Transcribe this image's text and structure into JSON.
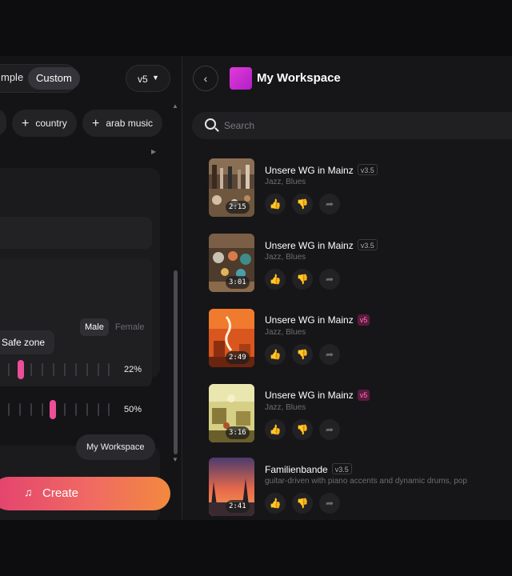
{
  "left": {
    "mode": {
      "simple_label": "mple",
      "custom_label": "Custom"
    },
    "version": {
      "label": "v5"
    },
    "chips": [
      {
        "label": "country"
      },
      {
        "label": "arab music"
      }
    ],
    "gender": {
      "male": "Male",
      "female": "Female"
    },
    "tooltip": "Safe zone",
    "sliders": [
      {
        "value": "22%"
      },
      {
        "value": "50%"
      }
    ],
    "workspace_button": "My Workspace",
    "create_button": "Create"
  },
  "right": {
    "workspace_title": "My Workspace",
    "search_placeholder": "Search",
    "songs": [
      {
        "title": "Unsere WG in Mainz",
        "version": "v3.5",
        "genres": "Jazz, Blues",
        "duration": "2:15"
      },
      {
        "title": "Unsere WG in Mainz",
        "version": "v3.5",
        "genres": "Jazz, Blues",
        "duration": "3:01"
      },
      {
        "title": "Unsere WG in Mainz",
        "version": "v5",
        "genres": "Jazz, Blues",
        "duration": "2:49"
      },
      {
        "title": "Unsere WG in Mainz",
        "version": "v5",
        "genres": "Jazz, Blues",
        "duration": "3:16"
      },
      {
        "title": "Familienbande",
        "version": "v3.5",
        "genres": "guitar-driven with piano accents and dynamic drums, pop",
        "duration": "2:41"
      }
    ]
  },
  "icons": {
    "back": "chevron-left-icon",
    "search": "search-icon",
    "like": "thumbs-up-icon",
    "dislike": "thumbs-down-icon",
    "share": "share-icon",
    "music_note": "music-note-icon",
    "plus": "plus-icon",
    "caret": "caret-down-icon"
  },
  "colors": {
    "accent_pink": "#ec4e9a",
    "create_gradient_start": "#e3426f",
    "create_gradient_end": "#f2893f",
    "workspace_avatar": "#d433d4",
    "version_v5": "#ff7ab6"
  }
}
